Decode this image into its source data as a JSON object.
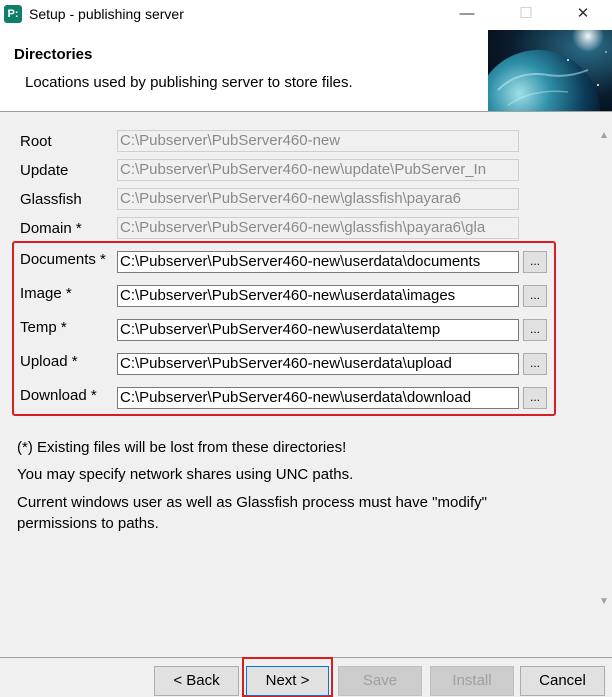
{
  "window": {
    "app_icon_text": "P:",
    "title": "Setup - publishing server",
    "minimize": "—",
    "maximize": "☐",
    "close": "✕"
  },
  "header": {
    "title": "Directories",
    "subtitle": "Locations used by publishing server to store files."
  },
  "fields": {
    "root": {
      "label": "Root",
      "value": "C:\\Pubserver\\PubServer460-new"
    },
    "update": {
      "label": "Update",
      "value": "C:\\Pubserver\\PubServer460-new\\update\\PubServer_In"
    },
    "glassfish": {
      "label": "Glassfish",
      "value": "C:\\Pubserver\\PubServer460-new\\glassfish\\payara6"
    },
    "domain": {
      "label": "Domain *",
      "value": "C:\\Pubserver\\PubServer460-new\\glassfish\\payara6\\gla"
    },
    "documents": {
      "label": "Documents *",
      "value": "C:\\Pubserver\\PubServer460-new\\userdata\\documents"
    },
    "image": {
      "label": "Image *",
      "value": "C:\\Pubserver\\PubServer460-new\\userdata\\images"
    },
    "temp": {
      "label": "Temp *",
      "value": "C:\\Pubserver\\PubServer460-new\\userdata\\temp"
    },
    "upload": {
      "label": "Upload *",
      "value": "C:\\Pubserver\\PubServer460-new\\userdata\\upload"
    },
    "download": {
      "label": "Download *",
      "value": "C:\\Pubserver\\PubServer460-new\\userdata\\download"
    }
  },
  "browse_label": "...",
  "notes": {
    "warning": "(*) Existing files will be lost from these directories!",
    "unc": "You may specify network shares using UNC paths.",
    "perm_line1": "Current windows user as well as Glassfish process must have \"modify\"",
    "perm_line2": "permissions to paths."
  },
  "buttons": {
    "back": "< Back",
    "next": "Next >",
    "save": "Save",
    "install": "Install",
    "cancel": "Cancel"
  },
  "colors": {
    "highlight": "#d81e1e",
    "app_icon": "#0f7f6a"
  }
}
